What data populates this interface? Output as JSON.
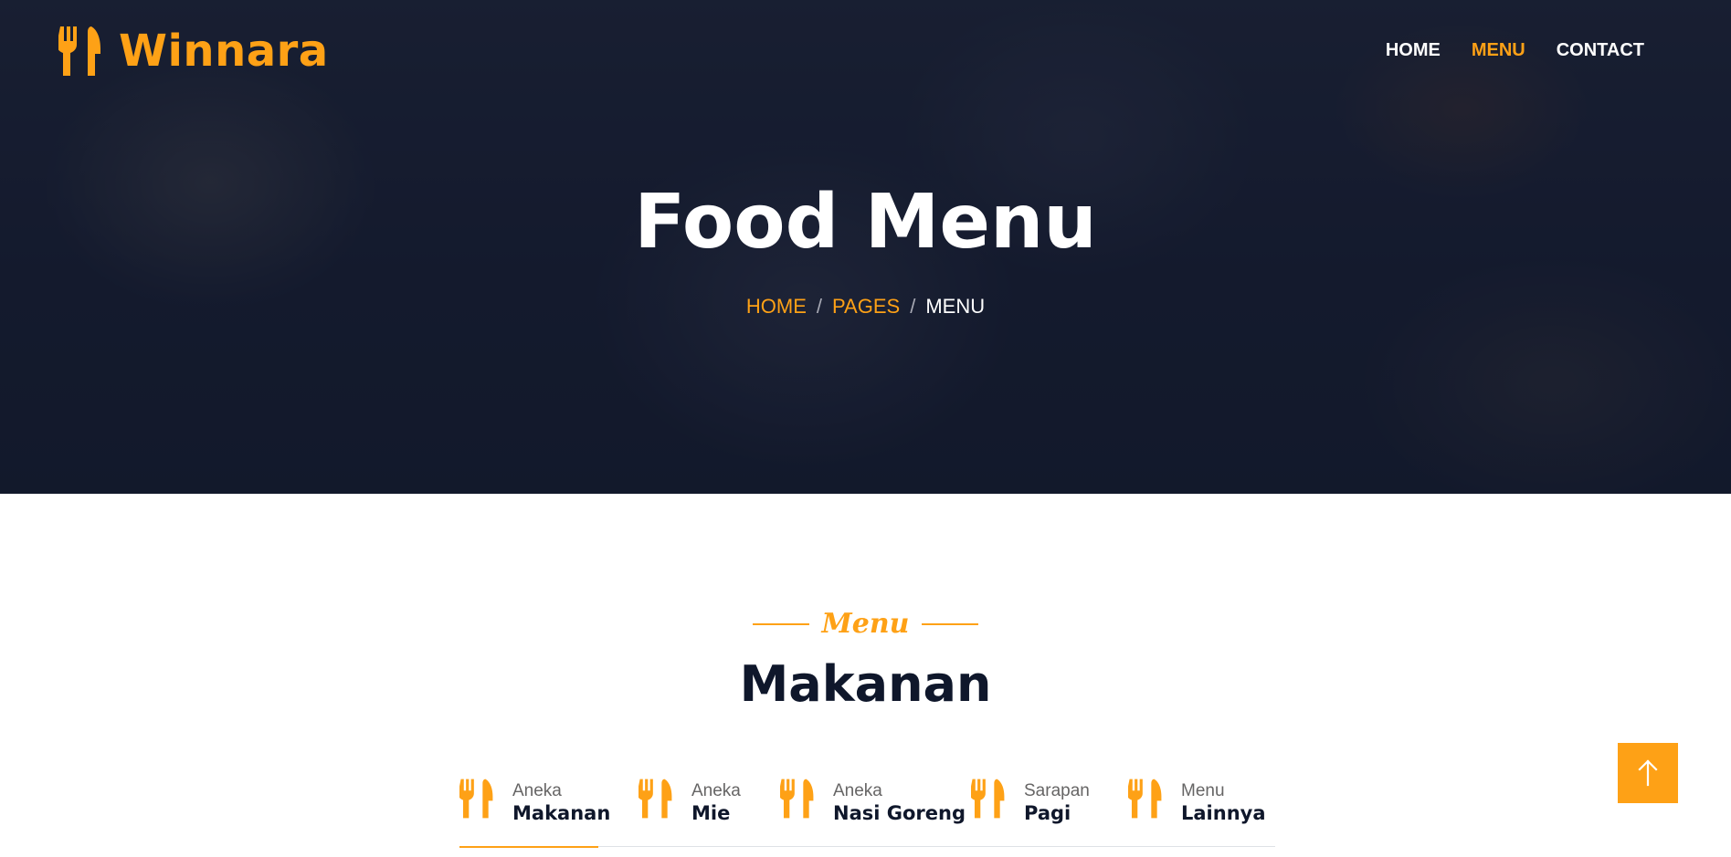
{
  "brand": {
    "name": "Winnara",
    "icon": "utensils-icon"
  },
  "nav": {
    "items": [
      {
        "label": "HOME",
        "active": false
      },
      {
        "label": "MENU",
        "active": true
      },
      {
        "label": "CONTACT",
        "active": false
      }
    ]
  },
  "hero": {
    "title": "Food Menu",
    "breadcrumb": [
      {
        "label": "HOME",
        "current": false
      },
      {
        "label": "PAGES",
        "current": false
      },
      {
        "label": "MENU",
        "current": true
      }
    ],
    "separator": "/"
  },
  "section": {
    "tag": "Menu",
    "title": "Makanan"
  },
  "tabs": [
    {
      "small": "Aneka",
      "big": "Makanan",
      "icon": "utensils-icon",
      "active": true
    },
    {
      "small": "Aneka",
      "big": "Mie",
      "icon": "utensils-icon",
      "active": false
    },
    {
      "small": "Aneka",
      "big": "Nasi Goreng",
      "icon": "utensils-icon",
      "active": false
    },
    {
      "small": "Sarapan",
      "big": "Pagi",
      "icon": "utensils-icon",
      "active": false
    },
    {
      "small": "Menu",
      "big": "Lainnya",
      "icon": "utensils-icon",
      "active": false
    }
  ],
  "back_to_top": {
    "icon": "arrow-up-icon"
  },
  "colors": {
    "accent": "#FEA116",
    "dark": "#0F172B",
    "hero_bg": "#1b1e30"
  }
}
